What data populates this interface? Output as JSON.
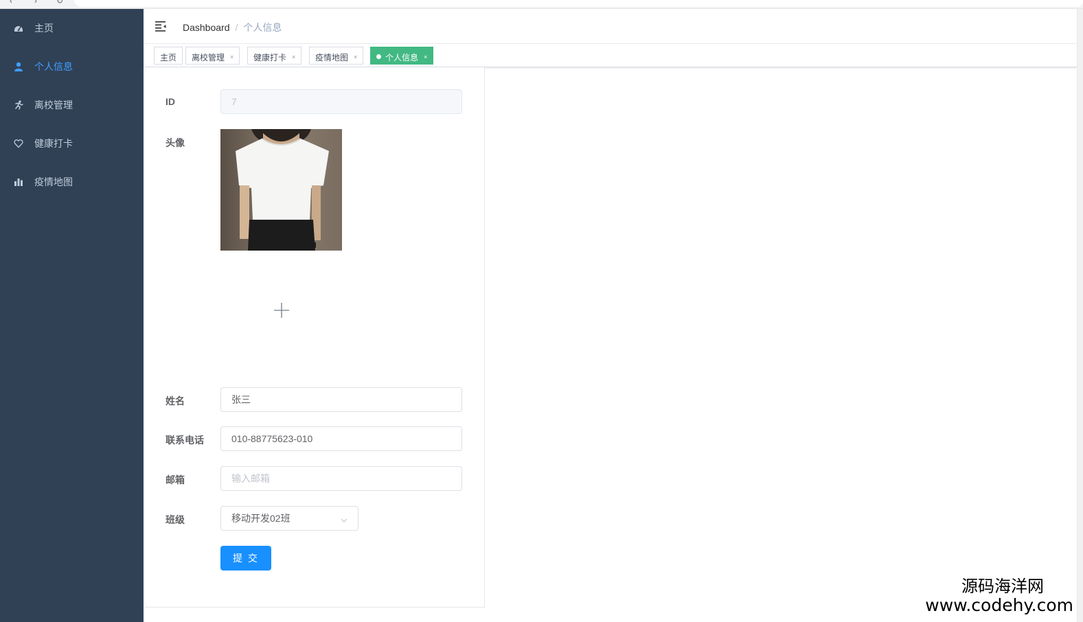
{
  "sidebar": {
    "items": [
      {
        "label": "主页",
        "icon": "dashboard-icon",
        "active": false
      },
      {
        "label": "个人信息",
        "icon": "user-icon",
        "active": true
      },
      {
        "label": "离校管理",
        "icon": "running-icon",
        "active": false
      },
      {
        "label": "健康打卡",
        "icon": "heart-icon",
        "active": false
      },
      {
        "label": "疫情地图",
        "icon": "bar-chart-icon",
        "active": false
      }
    ],
    "colors": {
      "background": "#304156",
      "text": "#bfcbd9",
      "active": "#409eff"
    }
  },
  "navbar": {
    "breadcrumb": {
      "first": "Dashboard",
      "separator": "/",
      "current": "个人信息"
    }
  },
  "tags": [
    {
      "label": "主页",
      "closable": false,
      "active": false
    },
    {
      "label": "离校管理",
      "closable": true,
      "active": false
    },
    {
      "label": "健康打卡",
      "closable": true,
      "active": false
    },
    {
      "label": "疫情地图",
      "closable": true,
      "active": false
    },
    {
      "label": "个人信息",
      "closable": true,
      "active": true
    }
  ],
  "tag_close_glyph": "×",
  "tag_active_color": "#42b983",
  "form": {
    "id": {
      "label": "ID",
      "value": "7"
    },
    "avatar": {
      "label": "头像",
      "upload_icon": "plus-icon"
    },
    "name": {
      "label": "姓名",
      "value": "张三"
    },
    "phone": {
      "label": "联系电话",
      "value": "010-88775623-010"
    },
    "email": {
      "label": "邮箱",
      "placeholder": "输入邮箱"
    },
    "class": {
      "label": "班级",
      "value": "移动开发02班"
    },
    "submit_label": "提 交",
    "submit_color": "#1890ff"
  },
  "watermark": {
    "line1": "源码海洋网",
    "line2": "www.codehy.com"
  }
}
